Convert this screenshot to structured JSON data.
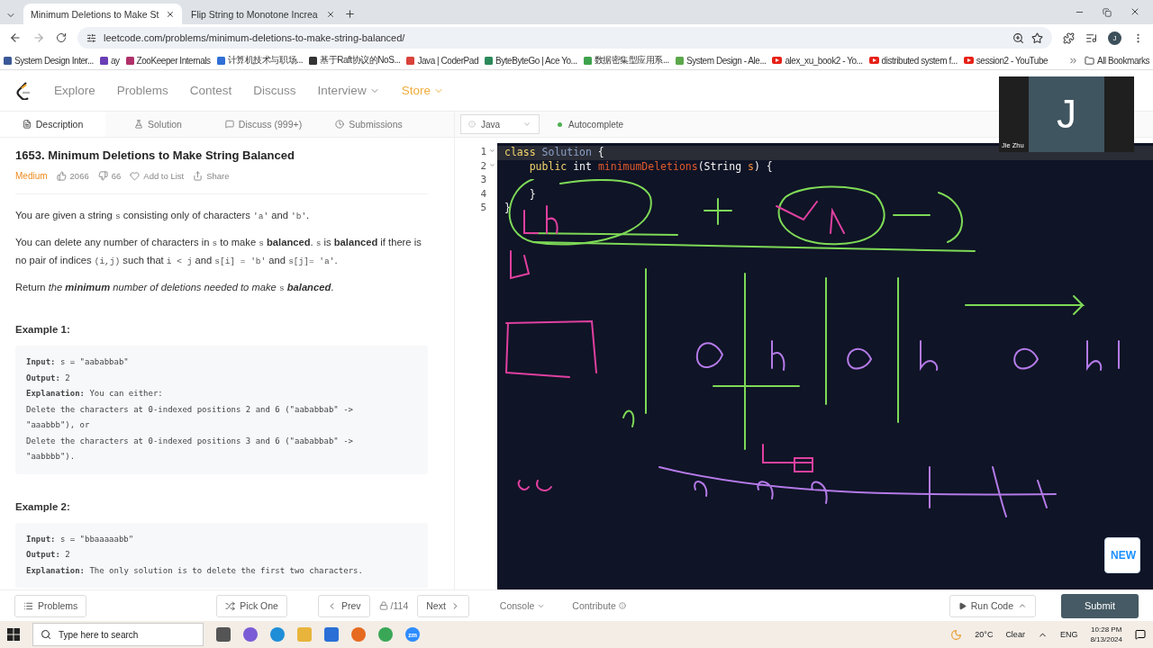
{
  "browser": {
    "tabs": [
      {
        "title": "Minimum Deletions to Make St",
        "selected": true
      },
      {
        "title": "Flip String to Monotone Increa",
        "selected": false
      }
    ],
    "url": "leetcode.com/problems/minimum-deletions-to-make-string-balanced/",
    "profile_initial": "J",
    "bookmarks": [
      {
        "label": "System Design Inter...",
        "kind": "square",
        "color": "#3b5998"
      },
      {
        "label": "ay",
        "kind": "square",
        "color": "#6a3fb5"
      },
      {
        "label": "ZooKeeper Internals",
        "kind": "square",
        "color": "#b0306a"
      },
      {
        "label": "计算机技术与职场...",
        "kind": "square",
        "color": "#2f6fd6"
      },
      {
        "label": "基于Raft协议的NoS...",
        "kind": "square",
        "color": "#333333"
      },
      {
        "label": "Java | CoderPad",
        "kind": "square",
        "color": "#d9433a"
      },
      {
        "label": "ByteByteGo | Ace Yo...",
        "kind": "square",
        "color": "#2c8a5a"
      },
      {
        "label": "数据密集型应用系...",
        "kind": "square",
        "color": "#3fa34d"
      },
      {
        "label": "System Design - Ale...",
        "kind": "square",
        "color": "#5aa84a"
      },
      {
        "label": "alex_xu_book2 - Yo...",
        "kind": "play",
        "color": "#e62117"
      },
      {
        "label": "distributed system f...",
        "kind": "play",
        "color": "#e62117"
      },
      {
        "label": "session2 - YouTube",
        "kind": "play",
        "color": "#e62117"
      }
    ],
    "all_bookmarks": "All Bookmarks"
  },
  "nav": [
    {
      "label": "Explore",
      "dropdown": false,
      "color": "#8c8c8c"
    },
    {
      "label": "Problems",
      "dropdown": false,
      "color": "#8c8c8c"
    },
    {
      "label": "Contest",
      "dropdown": false,
      "color": "#8c8c8c"
    },
    {
      "label": "Discuss",
      "dropdown": false,
      "color": "#8c8c8c"
    },
    {
      "label": "Interview",
      "dropdown": true,
      "color": "#8c8c8c"
    },
    {
      "label": "Store",
      "dropdown": true,
      "color": "#f0ad3c"
    }
  ],
  "panel_tabs": [
    {
      "label": "Description",
      "selected": true
    },
    {
      "label": "Solution",
      "selected": false
    },
    {
      "label": "Discuss (999+)",
      "selected": false
    },
    {
      "label": "Submissions",
      "selected": false
    }
  ],
  "problem": {
    "title": "1653. Minimum Deletions to Make String Balanced",
    "difficulty": "Medium",
    "likes": "2066",
    "dislikes": "66",
    "add_to_list": "Add to List",
    "share": "Share",
    "paragraphs": [
      [
        {
          "kind": "plain",
          "text": "You are given a string "
        },
        {
          "kind": "code",
          "text": "s"
        },
        {
          "kind": "plain",
          "text": " consisting only of characters "
        },
        {
          "kind": "code",
          "text": "'a'"
        },
        {
          "kind": "plain",
          "text": " and "
        },
        {
          "kind": "code",
          "text": "'b'"
        },
        {
          "kind": "plain",
          "text": "."
        }
      ],
      [
        {
          "kind": "plain",
          "text": "You can delete any number of characters in "
        },
        {
          "kind": "code",
          "text": "s"
        },
        {
          "kind": "plain",
          "text": " to make "
        },
        {
          "kind": "code",
          "text": "s"
        },
        {
          "kind": "bold",
          "text": " balanced"
        },
        {
          "kind": "plain",
          "text": ". "
        },
        {
          "kind": "code",
          "text": "s"
        },
        {
          "kind": "plain",
          "text": " is "
        },
        {
          "kind": "bold",
          "text": "balanced"
        },
        {
          "kind": "plain",
          "text": " if there is no pair of indices "
        },
        {
          "kind": "code",
          "text": "(i,j)"
        },
        {
          "kind": "plain",
          "text": " such that "
        },
        {
          "kind": "code",
          "text": "i < j"
        },
        {
          "kind": "plain",
          "text": " and "
        },
        {
          "kind": "code",
          "text": "s[i] = 'b'"
        },
        {
          "kind": "plain",
          "text": " and "
        },
        {
          "kind": "code",
          "text": "s[j]= 'a'"
        },
        {
          "kind": "plain",
          "text": "."
        }
      ],
      [
        {
          "kind": "plain",
          "text": "Return "
        },
        {
          "kind": "italic",
          "text": "the "
        },
        {
          "kind": "bold-italic",
          "text": "minimum"
        },
        {
          "kind": "italic",
          "text": " number of deletions needed to make "
        },
        {
          "kind": "code",
          "text": "s"
        },
        {
          "kind": "bold-italic",
          "text": " balanced"
        },
        {
          "kind": "plain",
          "text": "."
        }
      ]
    ],
    "examples": [
      {
        "title": "Example 1:",
        "lines": [
          {
            "label": "Input:",
            "text": " s = \"aababbab\""
          },
          {
            "label": "Output:",
            "text": " 2"
          },
          {
            "label": "Explanation:",
            "text": " You can either:"
          },
          {
            "text": "Delete the characters at 0-indexed positions 2 and 6 (\"aababbab\" ->"
          },
          {
            "text": "\"aaabbb\"), or"
          },
          {
            "text": "Delete the characters at 0-indexed positions 3 and 6 (\"aababbab\" ->"
          },
          {
            "text": "\"aabbbb\")."
          }
        ]
      },
      {
        "title": "Example 2:",
        "lines": [
          {
            "label": "Input:",
            "text": " s = \"bbaaaaabb\""
          },
          {
            "label": "Output:",
            "text": " 2"
          },
          {
            "label": "Explanation:",
            "text": " The only solution is to delete the first two characters."
          }
        ]
      }
    ]
  },
  "editor": {
    "language": "Java",
    "autocomplete": "Autocomplete",
    "lines": [
      {
        "number": "1",
        "fold": true,
        "tokens": [
          {
            "kind": "keyword",
            "text": "class "
          },
          {
            "kind": "type",
            "text": "Solution"
          },
          {
            "kind": "plain",
            "text": " {"
          }
        ]
      },
      {
        "number": "2",
        "fold": true,
        "tokens": [
          {
            "kind": "keyword",
            "text": "    public "
          },
          {
            "kind": "plain",
            "text": "int "
          },
          {
            "kind": "method",
            "text": "minimumDeletions"
          },
          {
            "kind": "plain",
            "text": "(String "
          },
          {
            "kind": "param",
            "text": "s"
          },
          {
            "kind": "plain",
            "text": ") {"
          }
        ]
      },
      {
        "number": "3",
        "fold": false
      },
      {
        "number": "4",
        "fold": false,
        "tokens": [
          {
            "kind": "plain",
            "text": "    }"
          }
        ]
      },
      {
        "number": "5",
        "fold": false,
        "tokens": [
          {
            "kind": "plain",
            "text": "}"
          }
        ]
      }
    ]
  },
  "video": {
    "initial": "J",
    "name": "Jie Zhu"
  },
  "new_badge": "NEW",
  "bottom_bar": {
    "problems": "Problems",
    "pick_one": "Pick One",
    "prev": "Prev",
    "counter": "/114",
    "next": "Next",
    "console": "Console",
    "contribute": "Contribute",
    "run_code": "Run Code",
    "submit": "Submit"
  },
  "taskbar": {
    "search_placeholder": "Type here to search",
    "zoom_label": "zm",
    "temperature": "20°C",
    "weather": "Clear",
    "language": "ENG",
    "time": "10:28 PM",
    "date": "8/13/2024"
  }
}
